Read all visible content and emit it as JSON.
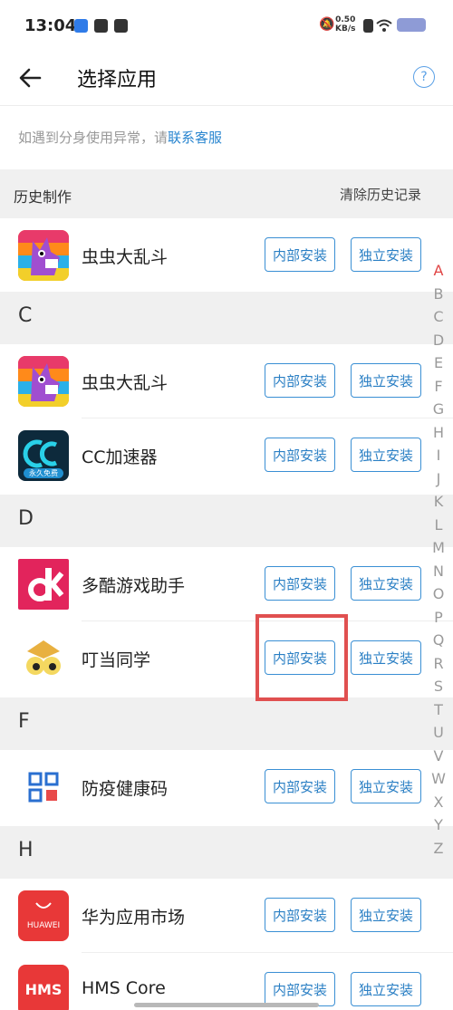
{
  "status": {
    "time": "13:04",
    "net_speed_value": "0.50",
    "net_speed_unit": "KB/s"
  },
  "header": {
    "title": "选择应用"
  },
  "notice": {
    "text": "如遇到分身使用异常，请",
    "link": "联系客服"
  },
  "history": {
    "title": "历史制作",
    "clear": "清除历史记录"
  },
  "buttons": {
    "internal": "内部安装",
    "independent": "独立安装"
  },
  "history_items": [
    {
      "name": "虫虫大乱斗",
      "icon": "chongchong-app-icon"
    }
  ],
  "sections": [
    {
      "letter": "C",
      "items": [
        {
          "name": "虫虫大乱斗",
          "icon": "chongchong-app-icon"
        },
        {
          "name": "CC加速器",
          "icon": "cc-accelerator-app-icon",
          "icon_badge": "永久免费"
        }
      ]
    },
    {
      "letter": "D",
      "items": [
        {
          "name": "多酷游戏助手",
          "icon": "duoku-app-icon"
        },
        {
          "name": "叮当同学",
          "icon": "dingdang-app-icon"
        }
      ]
    },
    {
      "letter": "F",
      "items": [
        {
          "name": "防疫健康码",
          "icon": "health-code-app-icon"
        }
      ]
    },
    {
      "letter": "H",
      "items": [
        {
          "name": "华为应用市场",
          "icon": "huawei-appgallery-icon",
          "icon_text": "HUAWEI"
        },
        {
          "name": "HMS Core",
          "icon": "hms-core-icon",
          "icon_text": "HMS"
        }
      ]
    }
  ],
  "index_letters": [
    "A",
    "B",
    "C",
    "D",
    "E",
    "F",
    "G",
    "H",
    "I",
    "J",
    "K",
    "L",
    "M",
    "N",
    "O",
    "P",
    "Q",
    "R",
    "S",
    "T",
    "U",
    "V",
    "W",
    "X",
    "Y",
    "Z"
  ],
  "index_active": "A",
  "colors": {
    "accent": "#2a86d0",
    "highlight_box": "#e05050",
    "section_bg": "#f0f0f0"
  }
}
